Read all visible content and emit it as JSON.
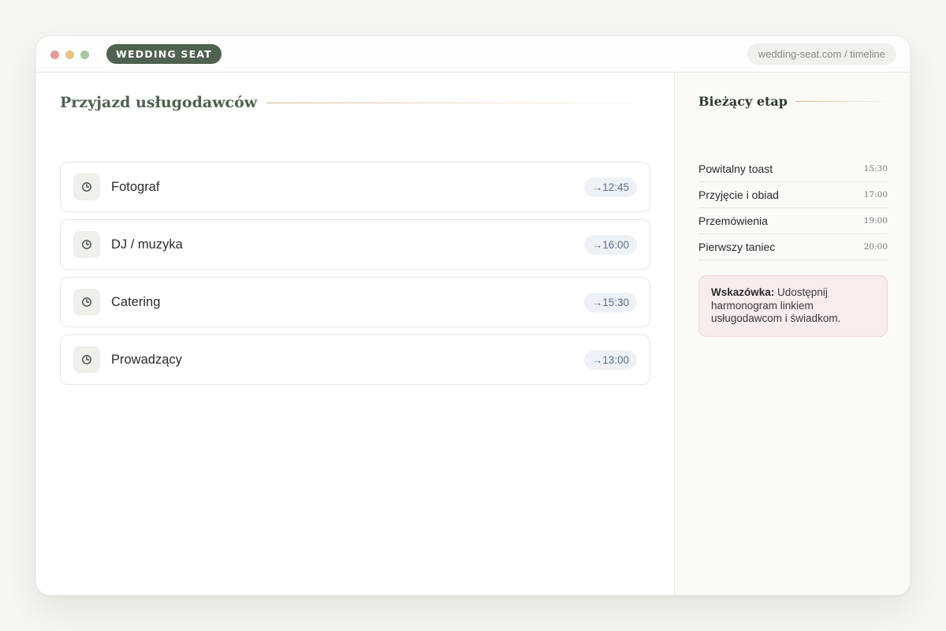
{
  "app": {
    "brand": "WEDDING SEAT",
    "url": "wedding-seat.com / timeline"
  },
  "main": {
    "section_title": "Przyjazd usługodawców",
    "vendors": [
      {
        "name": "Fotograf",
        "time": "→12:45",
        "icon": "clock-icon"
      },
      {
        "name": "DJ / muzyka",
        "time": "→16:00",
        "icon": "clock-icon"
      },
      {
        "name": "Catering",
        "time": "→15:30",
        "icon": "clock-icon"
      },
      {
        "name": "Prowadzący",
        "time": "→13:00",
        "icon": "clock-icon"
      }
    ]
  },
  "sidebar": {
    "title": "Bieżący etap",
    "stages": [
      {
        "name": "Powitalny toast",
        "time": "15:30"
      },
      {
        "name": "Przyjęcie i obiad",
        "time": "17:00"
      },
      {
        "name": "Przemówienia",
        "time": "19:00"
      },
      {
        "name": "Pierwszy taniec",
        "time": "20:00"
      }
    ],
    "tip": {
      "label": "Wskazówka:",
      "text": " Udostępnij harmonogram linkiem usługodawcom i świadkom."
    }
  },
  "colors": {
    "brand": "#4f614f",
    "accent_rule": "#d4b78b",
    "time_pill": "#eef2f7",
    "tip_bg": "#f8ecec"
  }
}
